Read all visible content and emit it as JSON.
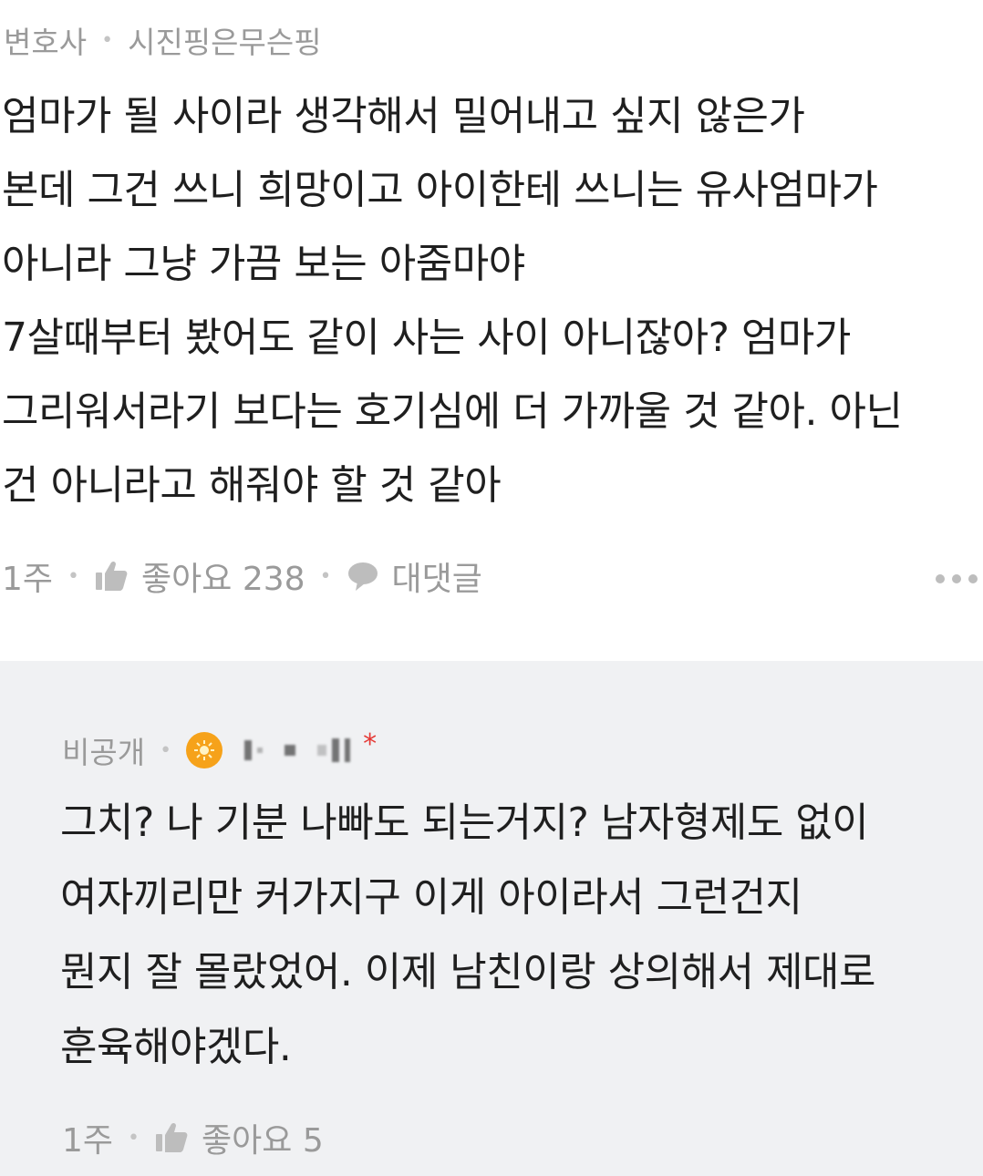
{
  "main_comment": {
    "badge": "변호사",
    "author": "시진핑은무슨핑",
    "body": "엄마가 될 사이라 생각해서 밀어내고 싶지 않은가\n본데 그건 쓰니 희망이고 아이한테 쓰니는 유사엄마가\n아니라 그냥 가끔 보는 아줌마야\n7살때부터 봤어도 같이 사는 사이 아니잖아? 엄마가\n그리워서라기 보다는 호기심에 더 가까울 것 같아. 아닌\n건 아니라고 해줘야 할 것 같아",
    "time": "1주",
    "like_label": "좋아요 238",
    "reply_label": "대댓글",
    "icons": [
      "thumbs-up-icon",
      "speech-bubble-icon",
      "more-icon"
    ]
  },
  "reply_comment": {
    "visibility": "비공개",
    "author_asterisk": "*",
    "body": "그치? 나 기분 나빠도 되는거지? 남자형제도 없이\n여자끼리만 커가지구 이게 아이라서 그런건지\n뭔지 잘 몰랐었어. 이제 남친이랑 상의해서 제대로\n훈육해야겠다.",
    "time": "1주",
    "like_label": "좋아요 5",
    "icons": [
      "author-badge-icon",
      "thumbs-up-icon"
    ]
  },
  "colors": {
    "reply_background": "#f0f1f3",
    "meta_text": "#9a9a9a",
    "body_text": "#1f1f1f",
    "badge": "#f6a21a",
    "asterisk": "#e53935"
  }
}
